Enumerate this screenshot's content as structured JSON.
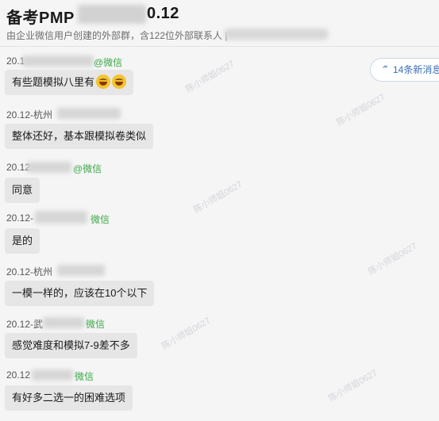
{
  "header": {
    "title_start": "备考PMP",
    "title_end": "0.12",
    "subtitle": "由企业微信用户创建的外部群，含122位外部联系人 |"
  },
  "new_messages": {
    "label": "14条新消息",
    "icon": "double-chevron-up-icon"
  },
  "messages": [
    {
      "sender_start": "20.1",
      "sender_end": "@微信",
      "text": "有些题模拟八里有"
    },
    {
      "sender_start": "20.12-杭州",
      "sender_end": "",
      "text": "整体还好，基本跟模拟卷类似"
    },
    {
      "sender_start": "20.12",
      "sender_end": "@微信",
      "text": "同意"
    },
    {
      "sender_start": "20.12-",
      "sender_end": "微信",
      "text": "是的"
    },
    {
      "sender_start": "20.12-杭州",
      "sender_end": "",
      "text": "一模一样的，应该在10个以下"
    },
    {
      "sender_start": "20.12-武",
      "sender_end": "微信",
      "text": "感觉难度和模拟7-9差不多"
    },
    {
      "sender_start": "20.12",
      "sender_end": "微信",
      "text": "有好多二选一的困难选项"
    }
  ],
  "watermark": "陈小师姐0627",
  "colors": {
    "bubble": "#e6e6e6",
    "wechat_green": "#3aa848",
    "accent_blue": "#3c6fb5"
  }
}
